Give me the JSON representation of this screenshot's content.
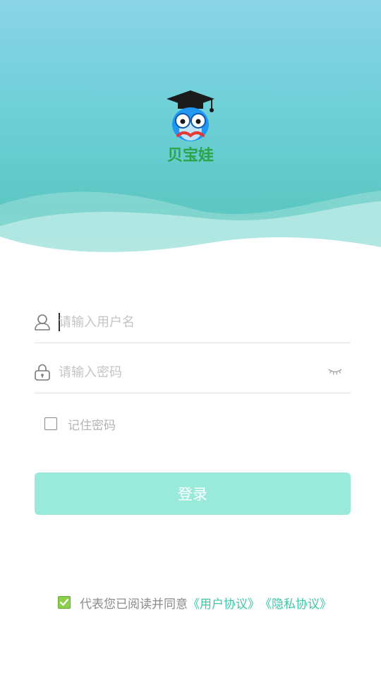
{
  "brand": {
    "logo_text": "贝宝娃"
  },
  "login": {
    "username_placeholder": "请输入用户名",
    "password_placeholder": "请输入密码",
    "remember_label": "记住密码",
    "submit_label": "登录"
  },
  "agreement": {
    "prefix": "代表您已阅读并同意",
    "user_agreement": "《用户协议》",
    "privacy_agreement": "《隐私协议》",
    "checked": true
  },
  "colors": {
    "accent": "#3fc6a8",
    "button_bg": "#9aeadb",
    "hero_top": "#8bd4e8",
    "hero_bottom": "#5dc7c3"
  }
}
